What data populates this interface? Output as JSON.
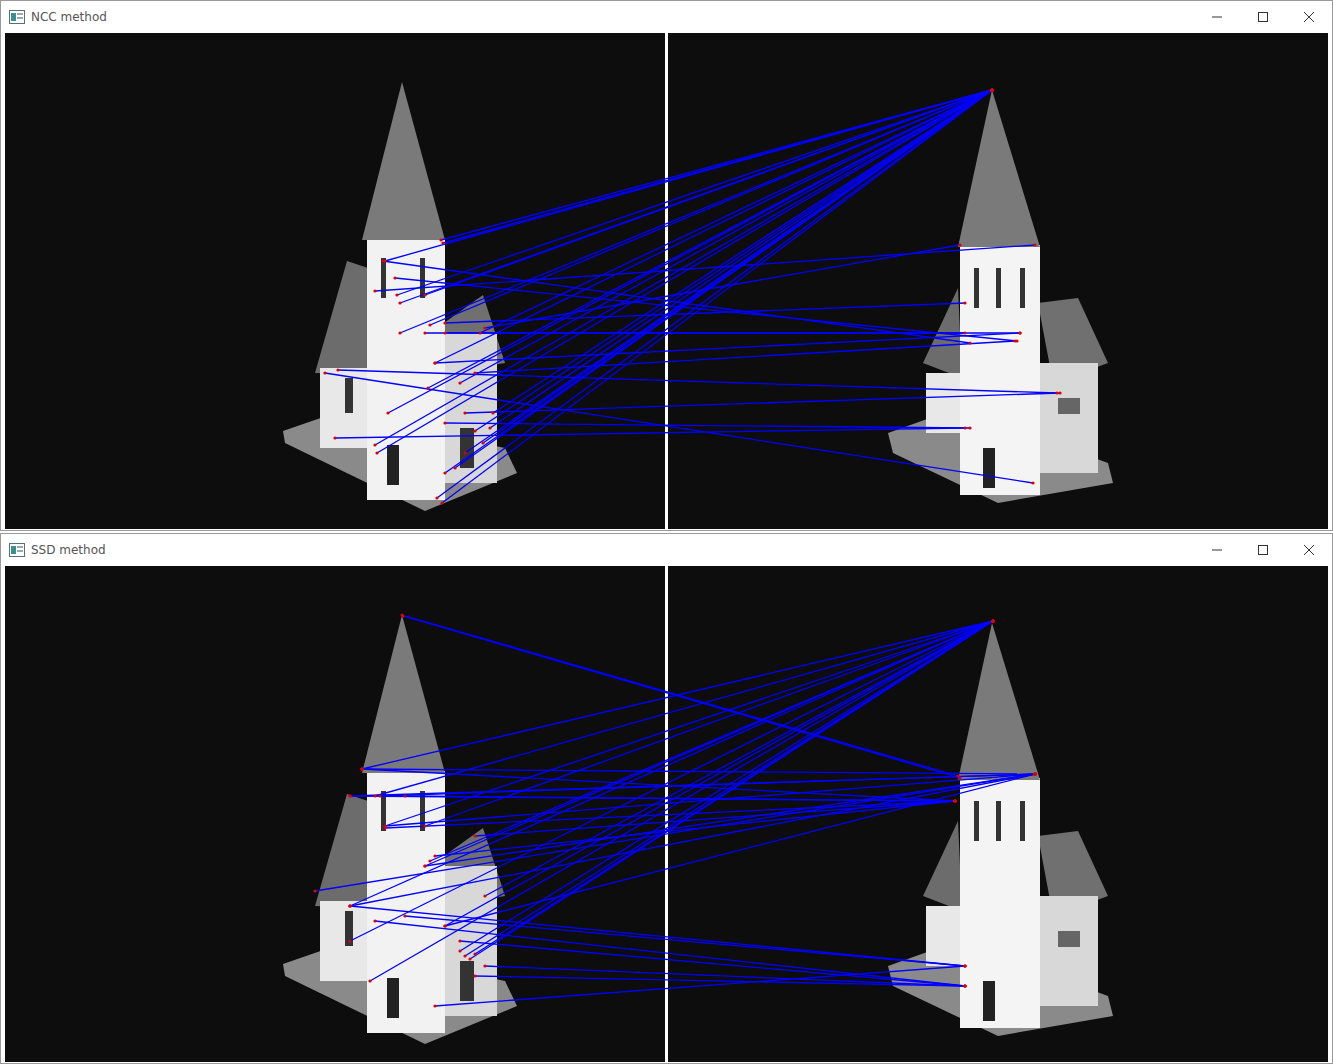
{
  "windows": [
    {
      "title": "NCC method"
    },
    {
      "title": "SSD method"
    }
  ]
}
